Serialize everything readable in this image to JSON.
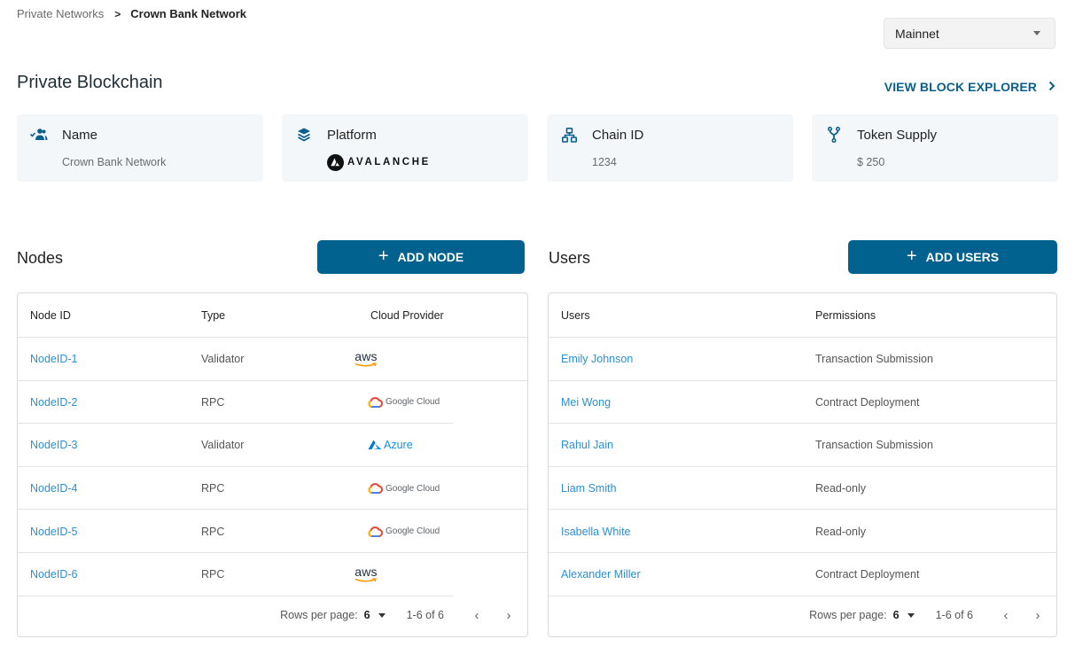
{
  "breadcrumb": {
    "parent": "Private Networks",
    "separator": ">",
    "current": "Crown Bank Network"
  },
  "network_select": {
    "value": "Mainnet",
    "icon": "caret-down-icon"
  },
  "page_title": "Private Blockchain",
  "explorer_link": {
    "label": "VIEW BLOCK EXPLORER",
    "icon": "chevron-right-icon"
  },
  "cards": [
    {
      "label": "Name",
      "icon": "users-check-icon",
      "value": "Crown Bank Network"
    },
    {
      "label": "Platform",
      "icon": "layers-icon",
      "value": "AVALANCHE",
      "logo": "avalanche-logo"
    },
    {
      "label": "Chain ID",
      "icon": "network-tree-icon",
      "value": "1234"
    },
    {
      "label": "Token Supply",
      "icon": "fork-icon",
      "value": "$ 250"
    }
  ],
  "nodes": {
    "title": "Nodes",
    "add_button": {
      "icon": "+",
      "label": "ADD NODE"
    },
    "columns": [
      "Node ID",
      "Type",
      "Cloud Provider"
    ],
    "rows": [
      {
        "id": "NodeID-1",
        "type": "Validator",
        "provider": "aws"
      },
      {
        "id": "NodeID-2",
        "type": "RPC",
        "provider": "Google Cloud"
      },
      {
        "id": "NodeID-3",
        "type": "Validator",
        "provider": "Azure"
      },
      {
        "id": "NodeID-4",
        "type": "RPC",
        "provider": "Google Cloud"
      },
      {
        "id": "NodeID-5",
        "type": "RPC",
        "provider": "Google Cloud"
      },
      {
        "id": "NodeID-6",
        "type": "RPC",
        "provider": "aws"
      }
    ],
    "pagination": {
      "rows_per_page_label": "Rows per page:",
      "rows_per_page": "6",
      "range": "1-6 of 6",
      "prev": "‹",
      "next": "›"
    }
  },
  "users": {
    "title": "Users",
    "add_button": {
      "icon": "+",
      "label": "ADD USERS"
    },
    "columns": [
      "Users",
      "Permissions"
    ],
    "rows": [
      {
        "name": "Emily Johnson",
        "permission": "Transaction Submission"
      },
      {
        "name": "Mei Wong",
        "permission": "Contract Deployment"
      },
      {
        "name": "Rahul Jain",
        "permission": "Transaction Submission"
      },
      {
        "name": "Liam Smith",
        "permission": "Read-only"
      },
      {
        "name": "Isabella White",
        "permission": "Read-only"
      },
      {
        "name": "Alexander Miller",
        "permission": "Contract Deployment"
      }
    ],
    "pagination": {
      "rows_per_page_label": "Rows per page:",
      "rows_per_page": "6",
      "range": "1-6 of 6",
      "prev": "‹",
      "next": "›"
    }
  },
  "colors": {
    "primary": "#01628f",
    "link": "#2b8fd6",
    "card_bg": "#f4f7fa",
    "icon": "#0a5f8c"
  }
}
